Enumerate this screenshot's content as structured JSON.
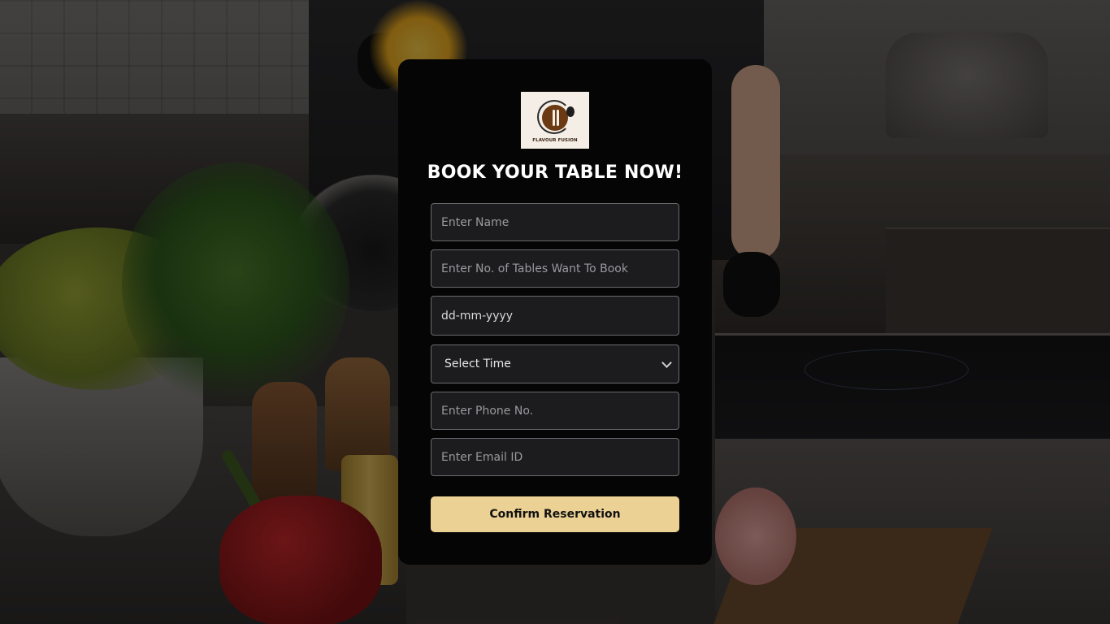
{
  "brand": {
    "logo_text": "FLAVOUR FUSION",
    "accent_color": "#ecd194",
    "card_color": "#050505"
  },
  "form": {
    "title": "BOOK YOUR TABLE NOW!",
    "name_placeholder": "Enter Name",
    "tables_placeholder": "Enter No. of Tables Want To Book",
    "date_value": "dd-mm-yyyy",
    "time_selected": "Select Time",
    "phone_placeholder": "Enter Phone No.",
    "email_placeholder": "Enter Email ID",
    "submit_label": "Confirm Reservation"
  }
}
